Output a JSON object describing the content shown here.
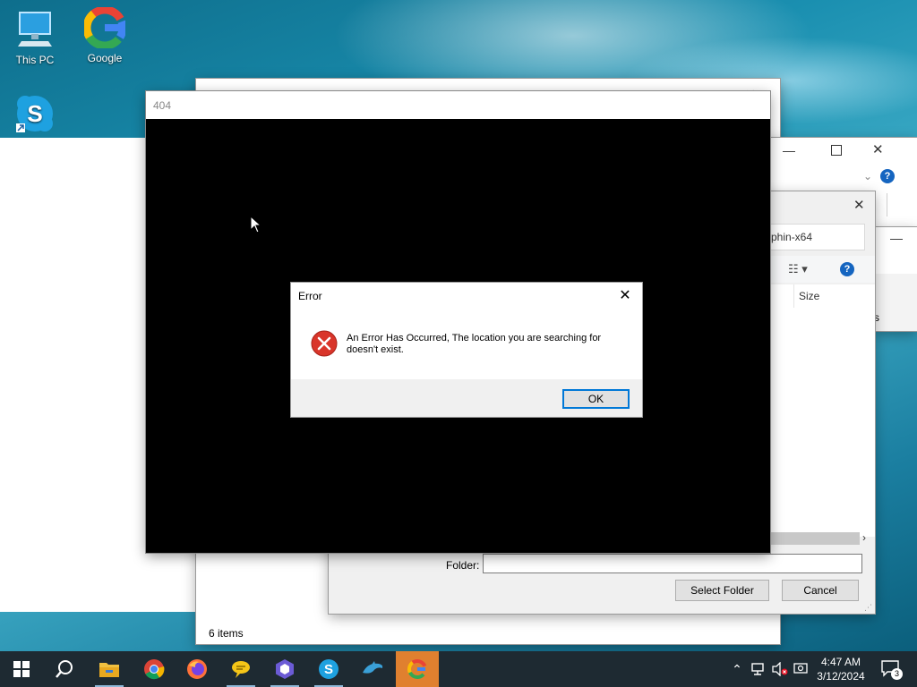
{
  "desktop": {
    "icons": [
      {
        "label": "This PC",
        "icon": "computer-icon"
      },
      {
        "label": "Google",
        "icon": "google-chrome-icon"
      },
      {
        "label": "",
        "icon": "skype-shortcut-icon"
      }
    ]
  },
  "explorer_window": {
    "status_text": "6 items",
    "path_fragment": "phin-x64",
    "column_size_label": "Size",
    "column_fragment": "s"
  },
  "folder_dialog": {
    "folder_label": "Folder:",
    "folder_value": "",
    "select_button": "Select Folder",
    "cancel_button": "Cancel"
  },
  "black_window": {
    "title": "404"
  },
  "error_dialog": {
    "title": "Error",
    "message": "An Error Has Occurred, The location you are searching for doesn't exist.",
    "ok_button": "OK",
    "icon": "error-x-icon"
  },
  "taskbar": {
    "apps": [
      "start-icon",
      "search-icon",
      "file-explorer-icon",
      "chrome-icon",
      "firefox-icon",
      "chat-icon",
      "app-icon",
      "skype-icon",
      "dolphin-icon",
      "google-icon"
    ],
    "time": "4:47 AM",
    "date": "3/12/2024",
    "notification_count": "3",
    "accent": "#e0802f"
  }
}
